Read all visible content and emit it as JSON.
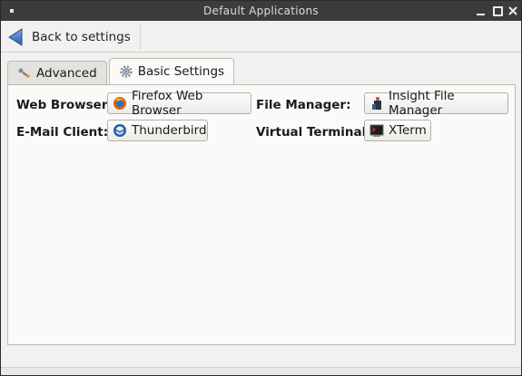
{
  "window": {
    "title": "Default Applications"
  },
  "toolbar": {
    "back_label": "Back to settings"
  },
  "tabs": [
    {
      "label": "Advanced",
      "icon": "advanced-icon",
      "active": false
    },
    {
      "label": "Basic Settings",
      "icon": "gear-icon",
      "active": true
    }
  ],
  "basic": {
    "web_browser": {
      "label": "Web Browser:",
      "value": "Firefox Web Browser",
      "icon": "firefox-icon"
    },
    "file_manager": {
      "label": "File Manager:",
      "value": "Insight File Manager",
      "icon": "file-manager-icon"
    },
    "email_client": {
      "label": "E-Mail Client:",
      "value": "Thunderbird",
      "icon": "thunderbird-icon"
    },
    "terminal": {
      "label": "Virtual Terminal:",
      "value": "XTerm",
      "icon": "terminal-icon"
    }
  },
  "colors": {
    "titlebar": "#3c3c3c",
    "panel": "#fbfaf9",
    "accent_back": "#3a6fb7"
  }
}
